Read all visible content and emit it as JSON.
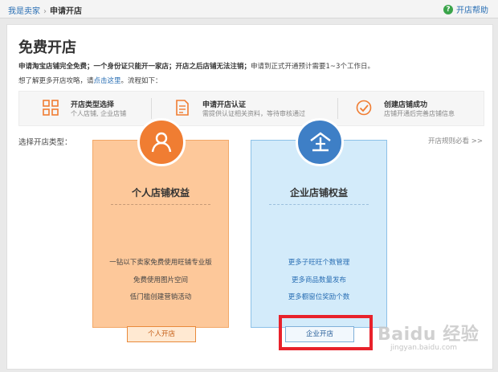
{
  "breadcrumb": {
    "link": "我是卖家",
    "separator": "›",
    "current": "申请开店"
  },
  "help": {
    "label": "开店帮助",
    "icon": "help-circle-icon"
  },
  "page": {
    "title": "免费开店",
    "intro_bold": "申请淘宝店铺完全免费；一个身份证只能开一家店；开店之后店铺无法注销；",
    "intro_rest": "申请到正式开通预计需要1~3个工作日。",
    "more_prefix": "想了解更多开店攻略，请",
    "more_link": "点击这里",
    "more_suffix": "。流程如下："
  },
  "steps": [
    {
      "icon": "grid-icon",
      "title": "开店类型选择",
      "desc": "个人店铺, 企业店铺"
    },
    {
      "icon": "document-icon",
      "title": "申请开店认证",
      "desc": "需提供认证相关资料，等待审核通过"
    },
    {
      "icon": "check-circle-icon",
      "title": "创建店铺成功",
      "desc": "店铺开通后完善店铺信息"
    }
  ],
  "choose_label": "选择开店类型：",
  "rules_link": "开店规则必看 >>",
  "personal": {
    "icon": "person-icon",
    "title": "个人店铺权益",
    "features": [
      "一钻以下卖家免费使用旺铺专业版",
      "免费使用图片空间",
      "低门槛创建营销活动"
    ],
    "button": "个人开店"
  },
  "business": {
    "icon": "enterprise-icon",
    "title": "企业店铺权益",
    "features": [
      "更多子旺旺个数管理",
      "更多商品数量发布",
      "更多橱窗位奖励个数"
    ],
    "button": "企业开店"
  },
  "watermark": {
    "brand": "Baidu 经验",
    "url": "jingyan.baidu.com"
  },
  "colors": {
    "orange": "#f07d32",
    "blue": "#3e7fc6",
    "highlight": "#e8222b"
  }
}
